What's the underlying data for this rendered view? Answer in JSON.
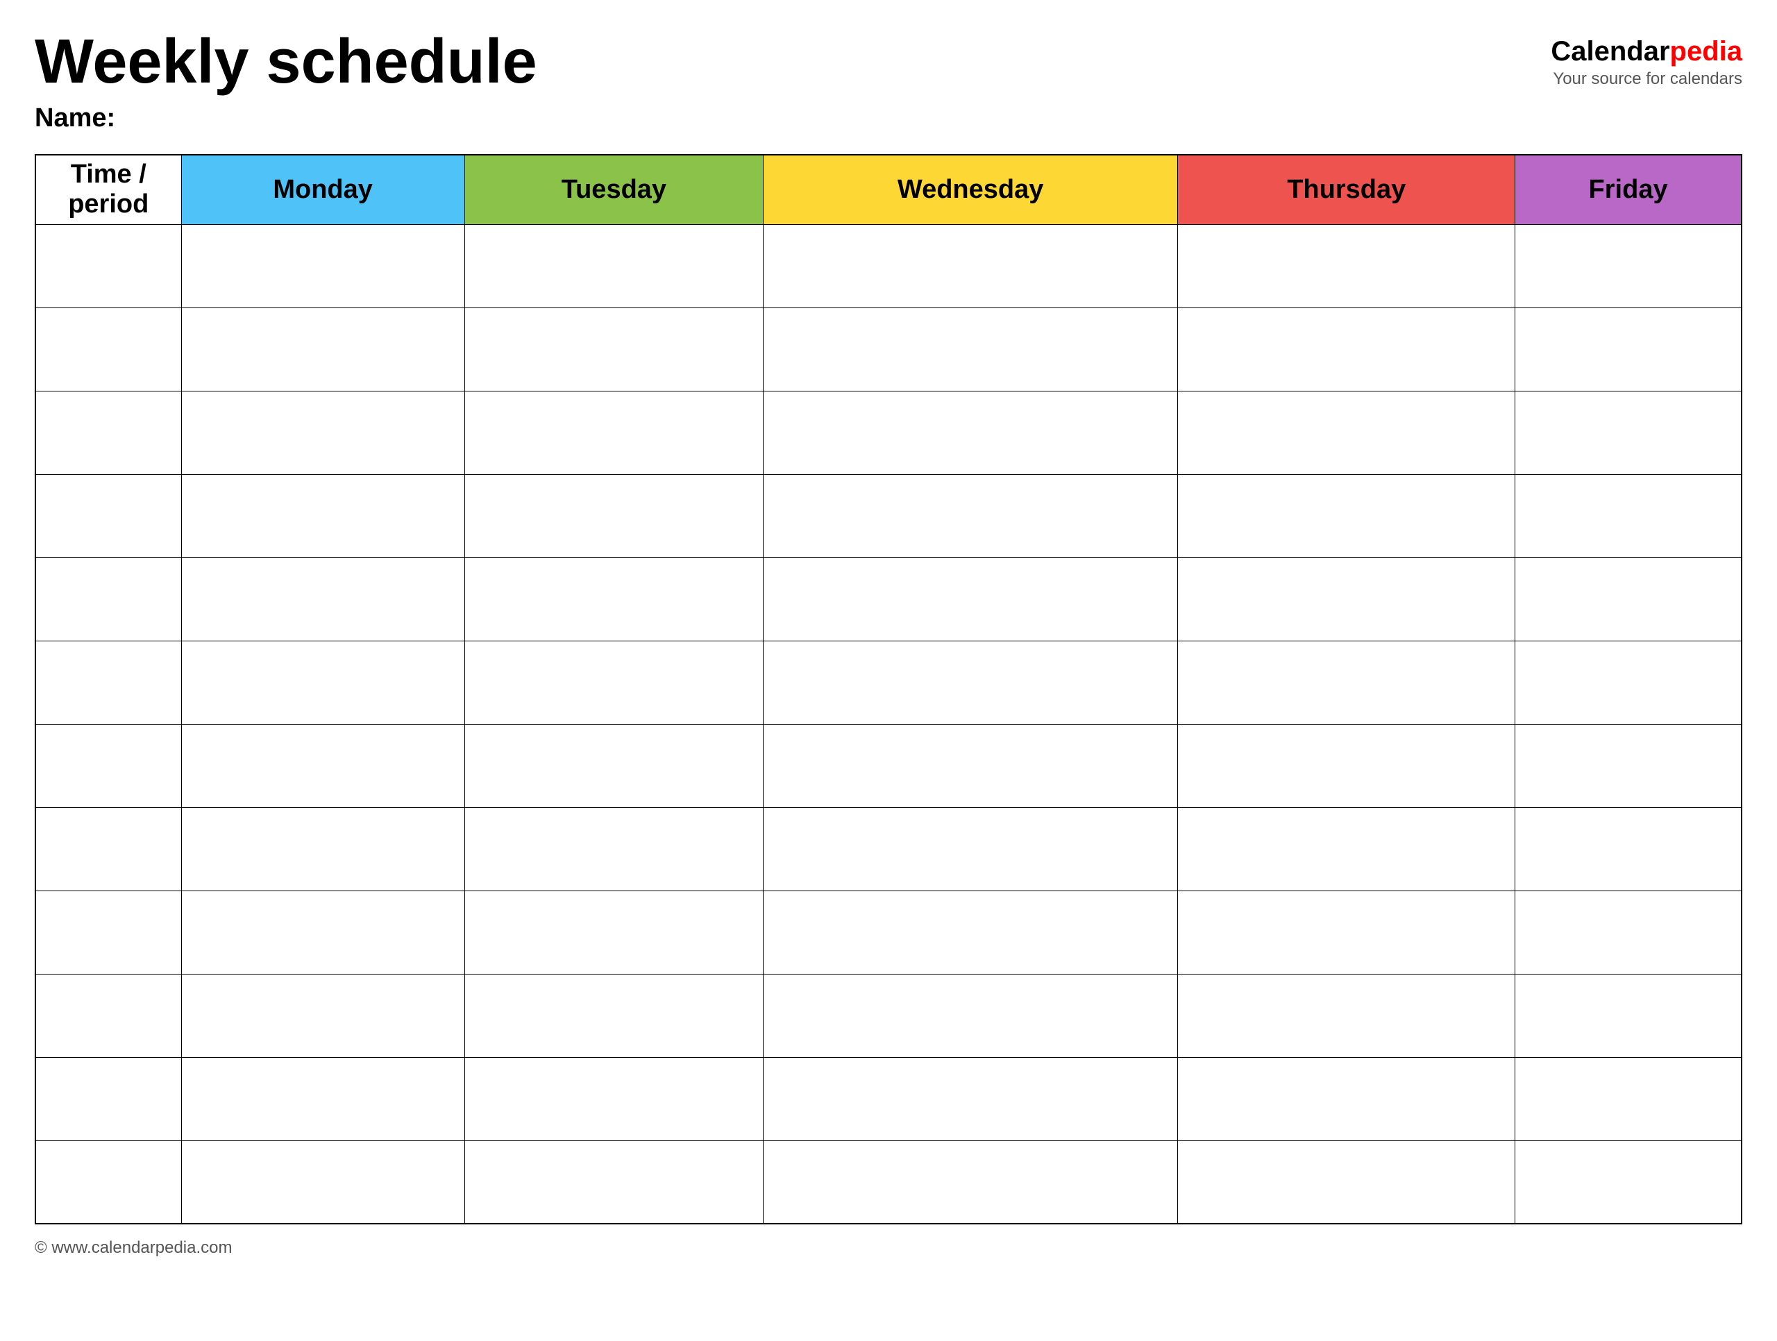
{
  "header": {
    "title": "Weekly schedule",
    "name_label": "Name:",
    "logo_brand": "Calendar",
    "logo_brand_red": "pedia",
    "logo_tagline": "Your source for calendars"
  },
  "table": {
    "columns": [
      {
        "key": "time",
        "label": "Time / period",
        "color_class": "th-time"
      },
      {
        "key": "monday",
        "label": "Monday",
        "color_class": "th-monday"
      },
      {
        "key": "tuesday",
        "label": "Tuesday",
        "color_class": "th-tuesday"
      },
      {
        "key": "wednesday",
        "label": "Wednesday",
        "color_class": "th-wednesday"
      },
      {
        "key": "thursday",
        "label": "Thursday",
        "color_class": "th-thursday"
      },
      {
        "key": "friday",
        "label": "Friday",
        "color_class": "th-friday"
      }
    ],
    "row_count": 12
  },
  "footer": {
    "url": "© www.calendarpedia.com"
  }
}
